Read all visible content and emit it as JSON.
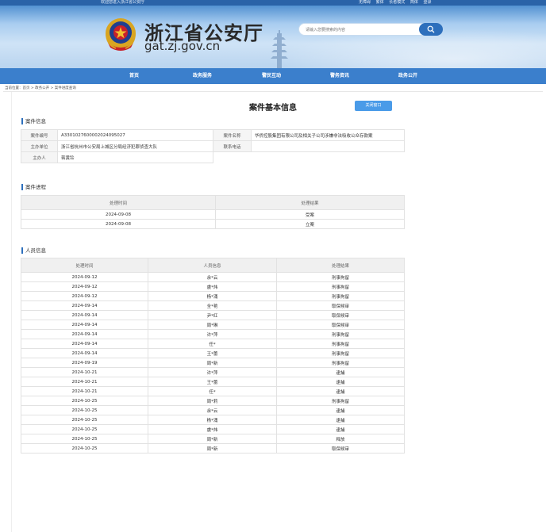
{
  "header": {
    "top_left": "欢迎您进入浙江省公安厅",
    "top_links": [
      "无障碍",
      "繁体",
      "长者模式",
      "简体",
      "登录"
    ],
    "site_title": "浙江省公安厅",
    "site_domain": "gat.zj.gov.cn",
    "search_placeholder": "请输入您要搜索的内容"
  },
  "nav": {
    "items": [
      "首页",
      "政务服务",
      "警民互动",
      "警务资讯",
      "政务公开"
    ]
  },
  "breadcrumb": "当前位置：首页 > 政务公开 > 案件进度查询",
  "page": {
    "title": "案件基本信息",
    "close_label": "关闭窗口"
  },
  "case_info": {
    "section_title": "案件信息",
    "case_no_label": "案件编号",
    "case_no": "A3301027600002024095027",
    "case_name_label": "案件名称",
    "case_name": "华侨控股集团有限公司及相关子公司涉嫌非法吸收公众存款案",
    "unit_label": "主办单位",
    "unit": "浙江省杭州市公安局上城区分局经济犯罪侦查大队",
    "phone_label": "联系电话",
    "phone": "",
    "officer_label": "主办人",
    "officer": "蒋黄铃"
  },
  "progress": {
    "section_title": "案件进程",
    "headers": [
      "处理时间",
      "处理结果"
    ],
    "rows": [
      [
        "2024-09-08",
        "受案"
      ],
      [
        "2024-09-08",
        "立案"
      ]
    ]
  },
  "persons": {
    "section_title": "人员信息",
    "headers": [
      "处理时间",
      "人员信息",
      "处理结果"
    ],
    "rows": [
      [
        "2024-09-12",
        "余*云",
        "刑事拘留"
      ],
      [
        "2024-09-12",
        "虞*炜",
        "刑事拘留"
      ],
      [
        "2024-09-12",
        "杨*涌",
        "刑事拘留"
      ],
      [
        "2024-09-14",
        "全*艳",
        "取保候审"
      ],
      [
        "2024-09-14",
        "尹*红",
        "取保候审"
      ],
      [
        "2024-09-14",
        "周*琳",
        "取保候审"
      ],
      [
        "2024-09-14",
        "许*萍",
        "刑事拘留"
      ],
      [
        "2024-09-14",
        "任*",
        "刑事拘留"
      ],
      [
        "2024-09-14",
        "王*蕾",
        "刑事拘留"
      ],
      [
        "2024-09-19",
        "周*新",
        "刑事拘留"
      ],
      [
        "2024-10-21",
        "许*萍",
        "逮捕"
      ],
      [
        "2024-10-21",
        "王*蕾",
        "逮捕"
      ],
      [
        "2024-10-21",
        "任*",
        "逮捕"
      ],
      [
        "2024-10-25",
        "周*莉",
        "刑事拘留"
      ],
      [
        "2024-10-25",
        "余*云",
        "逮捕"
      ],
      [
        "2024-10-25",
        "杨*涌",
        "逮捕"
      ],
      [
        "2024-10-25",
        "虞*炜",
        "逮捕"
      ],
      [
        "2024-10-25",
        "周*新",
        "释放"
      ],
      [
        "2024-10-25",
        "周*新",
        "取保候审"
      ]
    ]
  },
  "colors": {
    "nav_bg": "#3b7fcc",
    "accent": "#2d6fbc",
    "button": "#4a9be8"
  },
  "icons": {
    "emblem": "police-emblem-icon",
    "search": "search-icon"
  }
}
